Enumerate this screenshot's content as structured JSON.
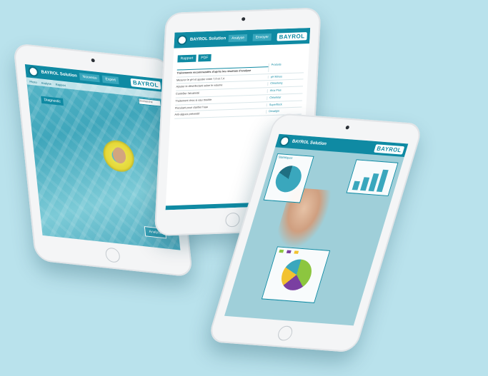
{
  "colors": {
    "background": "#b9e2ec",
    "brand_teal": "#0f8aa3",
    "pie_teal": "#3aa7bd",
    "pie_green": "#8cc63f",
    "pie_purple": "#7a3fa1",
    "pie_yellow": "#f2c230"
  },
  "brand": {
    "logo_text": "BAYROL",
    "app_name": "BAYROL Solution"
  },
  "left_tablet": {
    "tabs": [
      "Nouveau",
      "Expert"
    ],
    "subnav": [
      "Photo",
      "Analyse",
      "Rapport"
    ],
    "side_button": "Diagnostic",
    "search_placeholder": "Recherche",
    "cta_label": "Analyse"
  },
  "middle_tablet": {
    "header_tab": "Analyse",
    "header_button": "Envoyer",
    "buttons": [
      "Rapport",
      "PDF"
    ],
    "section_title": "Traitements recommandés d'après les résultats d'analyse",
    "right_header": "Produits",
    "rows": [
      {
        "text": "Mesurer le pH et ajuster entre 7,0 et 7,4",
        "product": "pH Minus"
      },
      {
        "text": "Ajouter le désinfectant selon le volume",
        "product": "Chlorilong"
      },
      {
        "text": "Contrôler l'alcalinité",
        "product": "Alca Plus"
      },
      {
        "text": "Traitement choc si eau trouble",
        "product": "Chloriklar"
      },
      {
        "text": "Floculant pour clarifier l'eau",
        "product": "Superflock"
      },
      {
        "text": "Anti-algues préventif",
        "product": "Desalgin"
      }
    ]
  },
  "right_tablet": {
    "logo_text": "BAYROL",
    "panel_title": "Statistiques"
  }
}
